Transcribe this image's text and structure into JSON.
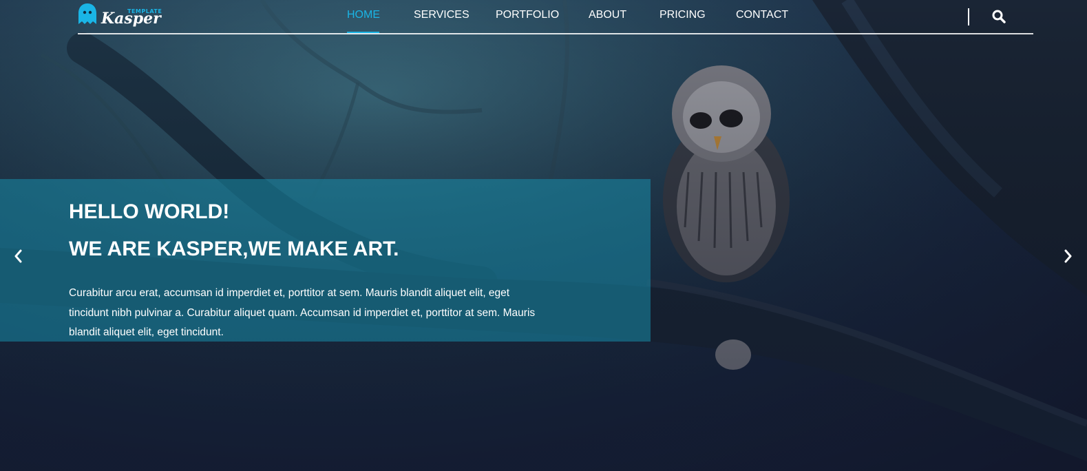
{
  "brand": {
    "name": "Kasper",
    "tag": "TEMPLATE",
    "accent": "#1ab5e6"
  },
  "nav": {
    "items": [
      {
        "label": "HOME",
        "active": true
      },
      {
        "label": "SERVICES",
        "active": false
      },
      {
        "label": "PORTFOLIO",
        "active": false
      },
      {
        "label": "ABOUT",
        "active": false
      },
      {
        "label": "PRICING",
        "active": false
      },
      {
        "label": "CONTACT",
        "active": false
      }
    ],
    "search_icon": "search-icon"
  },
  "hero": {
    "title_line1": "HELLO WORLD!",
    "title_line2": "WE ARE KASPER,WE MAKE ART.",
    "text": "Curabitur arcu erat, accumsan id imperdiet et, porttitor at sem. Mauris blandit aliquet elit, eget tincidunt nibh pulvinar a. Curabitur aliquet quam. Accumsan id imperdiet et, porttitor at sem. Mauris blandit aliquet elit, eget tincidunt.",
    "prev_icon": "chevron-left-icon",
    "next_icon": "chevron-right-icon"
  }
}
